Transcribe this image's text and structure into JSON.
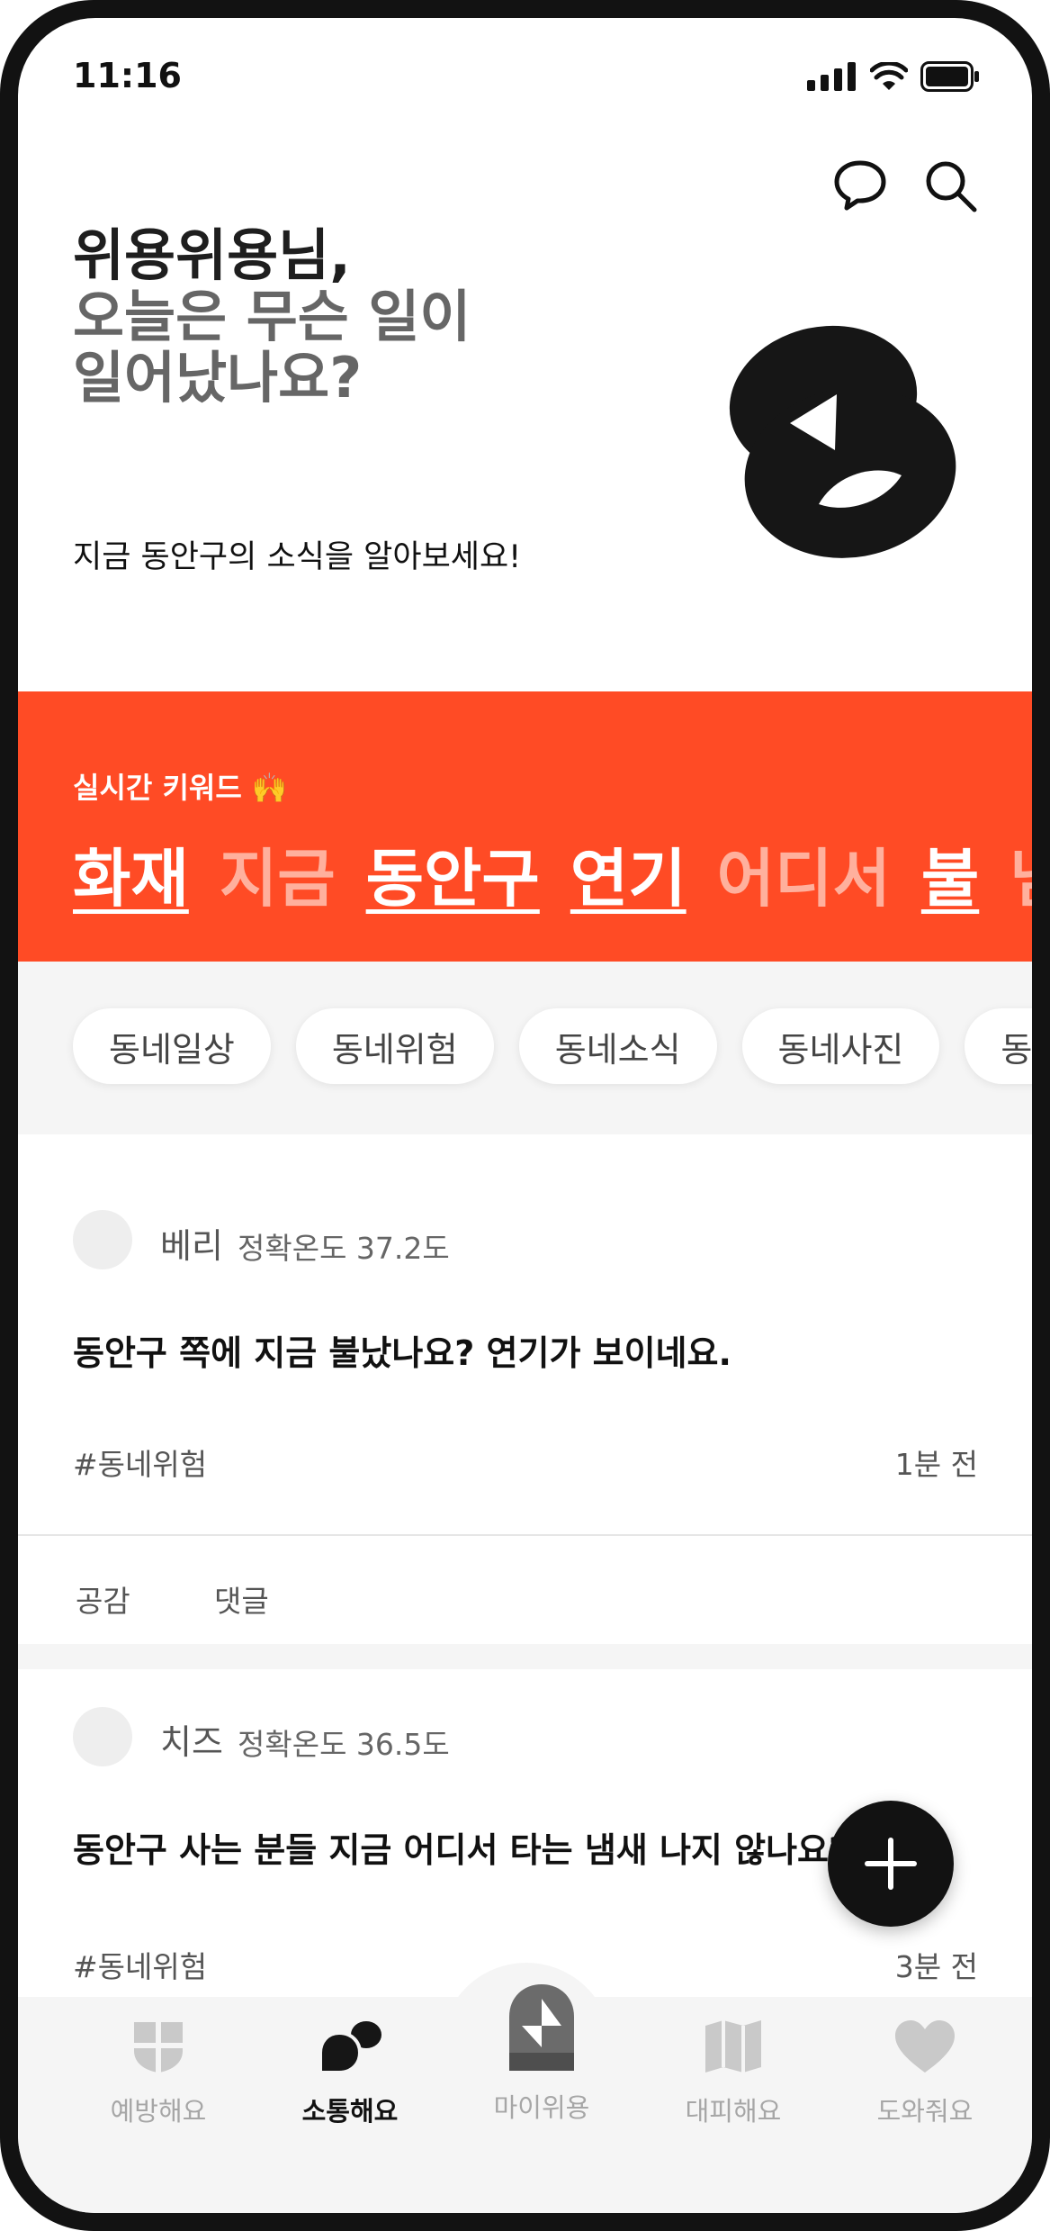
{
  "status_bar": {
    "time": "11:16"
  },
  "header": {
    "greeting": "위용위용님,",
    "question_line1": "오늘은 무슨 일이",
    "question_line2": "일어났나요?",
    "subtitle": "지금 동안구의 소식을 알아보세요!"
  },
  "trending": {
    "label": "실시간 키워드 🙌",
    "keywords": [
      {
        "text": "화재",
        "active": true
      },
      {
        "text": "지금",
        "active": false
      },
      {
        "text": "동안구",
        "active": true
      },
      {
        "text": "연기",
        "active": true
      },
      {
        "text": "어디서",
        "active": false
      },
      {
        "text": "불",
        "active": true
      },
      {
        "text": "냄새",
        "active": false
      }
    ]
  },
  "categories": [
    "동네일상",
    "동네위험",
    "동네소식",
    "동네사진",
    "동네"
  ],
  "posts": [
    {
      "author": "베리",
      "temperature": "정확온도 37.2도",
      "text": "동안구 쪽에 지금 불났나요? 연기가 보이네요.",
      "tag": "#동네위험",
      "time": "1분 전",
      "like_label": "공감",
      "comment_label": "댓글"
    },
    {
      "author": "치즈",
      "temperature": "정확온도 36.5도",
      "text": "동안구 사는 분들 지금 어디서 타는 냄새 나지 않나요?",
      "tag": "#동네위험",
      "time": "3분 전"
    }
  ],
  "tabbar": {
    "items": [
      {
        "label": "예방해요",
        "icon": "shield-grid-icon",
        "active": false
      },
      {
        "label": "소통해요",
        "icon": "chat-bubbles-icon",
        "active": true
      },
      {
        "label": "마이위용",
        "icon": "mascot-icon",
        "active": false
      },
      {
        "label": "대피해요",
        "icon": "map-icon",
        "active": false
      },
      {
        "label": "도와줘요",
        "icon": "heart-icon",
        "active": false
      }
    ]
  },
  "colors": {
    "accent": "#ff4b25",
    "dark": "#121212",
    "muted": "#a6a6a6"
  }
}
